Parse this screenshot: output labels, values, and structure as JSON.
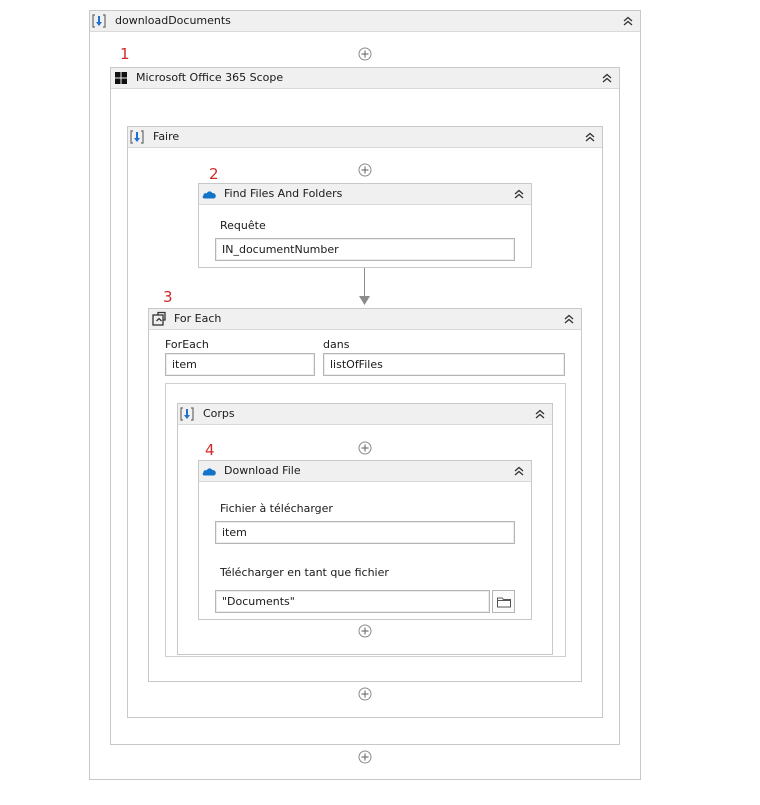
{
  "annotations": [
    "1",
    "2",
    "3",
    "4"
  ],
  "outer_sequence": {
    "title": "downloadDocuments",
    "icon": "sequence-icon"
  },
  "office_scope": {
    "title": "Microsoft Office 365 Scope",
    "icon": "microsoft-windows-icon"
  },
  "do_sequence": {
    "title": "Faire",
    "icon": "sequence-icon"
  },
  "find_files": {
    "title": "Find Files And Folders",
    "icon": "onedrive-cloud-icon",
    "query_label": "Requête",
    "query_value": "IN_documentNumber"
  },
  "for_each": {
    "title": "For Each",
    "icon": "for-each-icon",
    "foreach_label": "ForEach",
    "foreach_value": "item",
    "in_label": "dans",
    "in_value": "listOfFiles"
  },
  "body_sequence": {
    "title": "Corps",
    "icon": "sequence-icon"
  },
  "download_file": {
    "title": "Download File",
    "icon": "onedrive-cloud-icon",
    "file_label": "Fichier à télécharger",
    "file_value": "item",
    "save_as_label": "Télécharger en tant que fichier",
    "save_as_value": "\"Documents\""
  },
  "colors": {
    "annotation": "#d22a2a",
    "sequence_icon": "#1f6fd1",
    "onedrive": "#1273c9",
    "header_bg": "#f0f0f0",
    "border": "#c8c8c8"
  }
}
